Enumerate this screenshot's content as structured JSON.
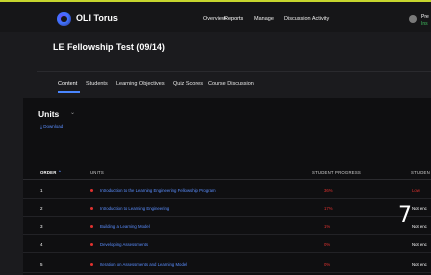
{
  "app": {
    "brand": "OLI Torus"
  },
  "nav": {
    "links": [
      "Overview",
      "Reports",
      "Manage",
      "Discussion Activity"
    ],
    "active": "Reports"
  },
  "user": {
    "name_truncated": "Pre",
    "subline": "Ins"
  },
  "page": {
    "title": "LE Fellowship Test (09/14)"
  },
  "tabs": [
    "Content",
    "Students",
    "Learning Objectives",
    "Quiz Scores",
    "Course Discussion"
  ],
  "active_tab": "Content",
  "content": {
    "heading": "Units",
    "chevron": "⌄",
    "download_label": "⤓ Download"
  },
  "table": {
    "columns": {
      "order": "ORDER",
      "sort_icon": "⌃",
      "units": "UNITS",
      "progress": "STUDENT PROGRESS",
      "engagement": "STUDEN"
    },
    "rows": [
      {
        "order": "1",
        "unit": "Introduction to the Learning Engineering Fellowship Program",
        "progress": "36%",
        "engagement": "Low"
      },
      {
        "order": "2",
        "unit": "Introduction to Learning Engineering",
        "progress": "17%",
        "engagement": "Not enc"
      },
      {
        "order": "3",
        "unit": "Building a Learning Model",
        "progress": "1%",
        "engagement": "Not enc"
      },
      {
        "order": "4",
        "unit": "Developing Assessments",
        "progress": "0%",
        "engagement": "Not enc"
      },
      {
        "order": "5",
        "unit": "Iteration on Assessments and Learning Model",
        "progress": "0%",
        "engagement": "Not enc"
      }
    ]
  },
  "overlay": {
    "glyph": "7"
  },
  "colors": {
    "accent_bar": "#c6d62e",
    "link_blue": "#5a8eff",
    "alert_red": "#e0322f",
    "status_green": "#3fbf5f"
  }
}
